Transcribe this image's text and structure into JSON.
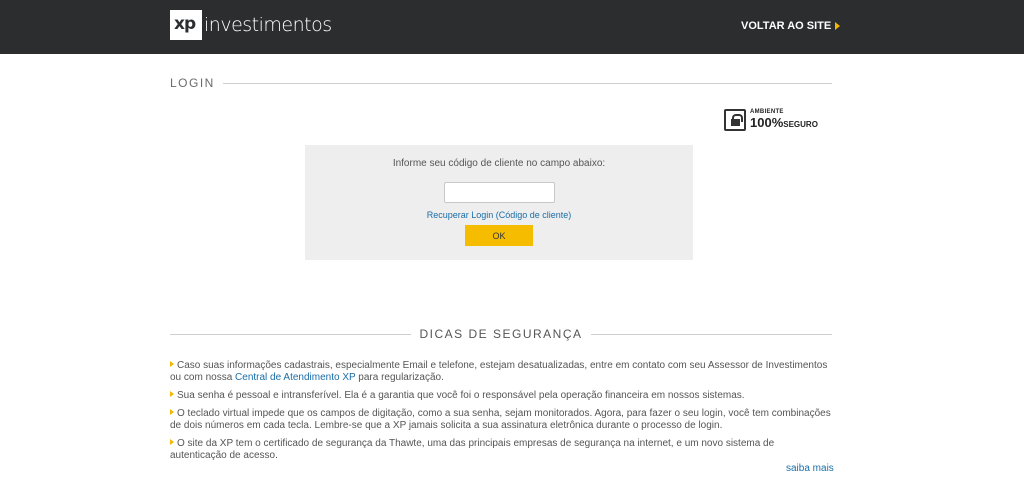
{
  "header": {
    "logo_mark": "xp",
    "logo_text": "investimentos",
    "back_label": "VOLTAR AO SITE"
  },
  "login": {
    "section_title": "LOGIN",
    "badge_small": "AMBIENTE",
    "badge_big": "100%",
    "badge_suffix": "SEGURO",
    "instruction": "Informe seu código de cliente no campo abaixo:",
    "input_value": "",
    "recover_label": "Recuperar Login (Código de cliente)",
    "ok_label": "OK"
  },
  "tips": {
    "title": "DICAS DE SEGURANÇA",
    "items": [
      {
        "before": "Caso suas informações cadastrais, especialmente Email e telefone, estejam desatualizadas, entre em contato com seu Assessor de Investimentos ou com nossa ",
        "link": "Central de Atendimento XP",
        "after": " para regularização."
      },
      {
        "text": "Sua senha é pessoal e intransferível. Ela é a garantia que você foi o responsável pela operação financeira em nossos sistemas."
      },
      {
        "text": "O teclado virtual impede que os campos de digitação, como a sua senha, sejam monitorados. Agora, para fazer o seu login, você tem combinações de dois números em cada tecla. Lembre-se que a XP jamais solicita a sua assinatura eletrônica durante o processo de login."
      },
      {
        "text": "O site da XP tem o certificado de segurança da Thawte, uma das principais empresas de segurança na internet, e um novo sistema de autenticação de acesso."
      }
    ],
    "more_label": "saiba mais"
  },
  "colors": {
    "header_bg": "#2b2d2f",
    "accent": "#f5bc00",
    "link": "#1a6ea8"
  }
}
